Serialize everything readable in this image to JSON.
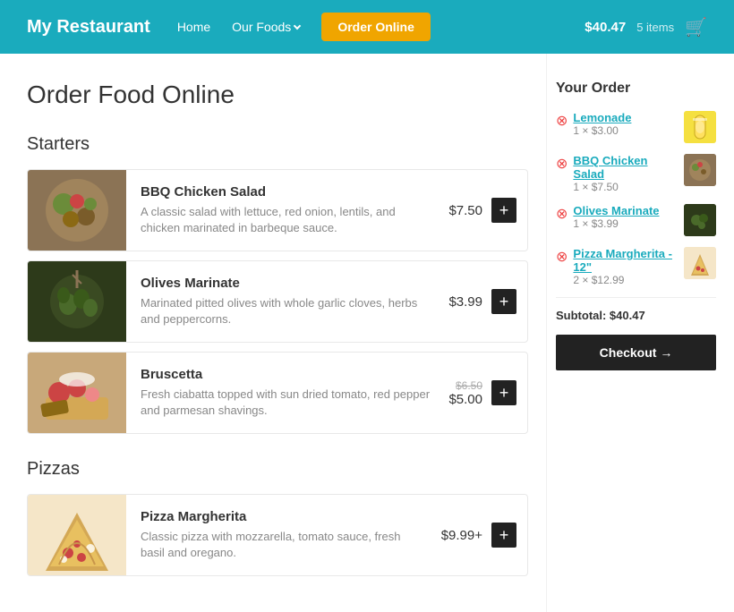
{
  "header": {
    "logo": "My Restaurant",
    "nav": [
      {
        "label": "Home",
        "href": "#"
      },
      {
        "label": "Our Foods",
        "href": "#",
        "dropdown": true
      },
      {
        "label": "Order Online",
        "href": "#",
        "active": true
      }
    ],
    "cart": {
      "amount": "$40.47",
      "items_label": "5 items"
    }
  },
  "page": {
    "title": "Order Food Online"
  },
  "menu": {
    "sections": [
      {
        "title": "Starters",
        "items": [
          {
            "name": "BBQ Chicken Salad",
            "description": "A classic salad with lettuce, red onion, lentils, and chicken marinated in barbeque sauce.",
            "price": "$7.50",
            "price_old": null,
            "add_label": "+"
          },
          {
            "name": "Olives Marinate",
            "description": "Marinated pitted olives with whole garlic cloves, herbs and peppercorns.",
            "price": "$3.99",
            "price_old": null,
            "add_label": "+"
          },
          {
            "name": "Bruscetta",
            "description": "Fresh ciabatta topped with sun dried tomato, red pepper and parmesan shavings.",
            "price": "$5.00",
            "price_old": "$6.50",
            "add_label": "+"
          }
        ]
      },
      {
        "title": "Pizzas",
        "items": [
          {
            "name": "Pizza Margherita",
            "description": "Classic pizza with mozzarella, tomato sauce, fresh basil and oregano.",
            "price": "$9.99+",
            "price_old": null,
            "add_label": "+"
          }
        ]
      }
    ]
  },
  "order": {
    "title": "Your Order",
    "items": [
      {
        "name": "Lemonade",
        "qty_label": "1 × $3.00"
      },
      {
        "name": "BBQ Chicken Salad",
        "qty_label": "1 × $7.50"
      },
      {
        "name": "Olives Marinate",
        "qty_label": "1 × $3.99"
      },
      {
        "name": "Pizza Margherita - 12\"",
        "qty_label": "2 × $12.99"
      }
    ],
    "subtotal_label": "Subtotal: $40.47",
    "checkout_label": "Checkout →"
  }
}
